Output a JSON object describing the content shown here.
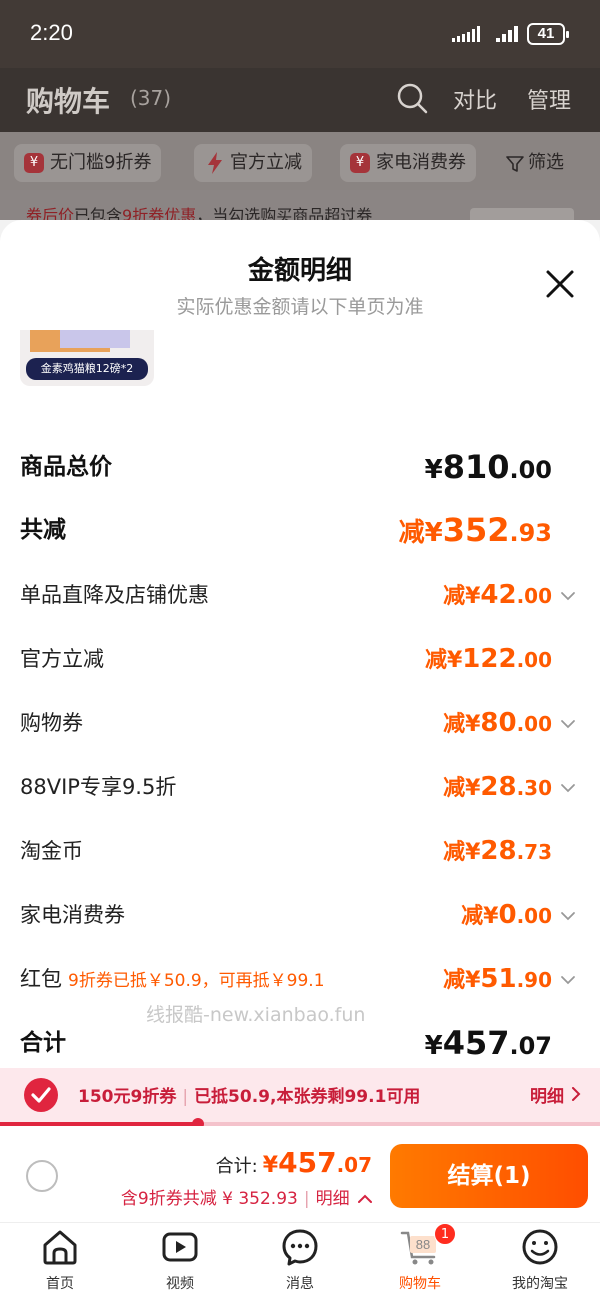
{
  "status_bar": {
    "time": "2:20",
    "battery": "41"
  },
  "cart_header": {
    "title": "购物车",
    "count": "(37)",
    "compare": "对比",
    "manage": "管理"
  },
  "filters": [
    {
      "label": "无门槛9折券",
      "icon": "coupon-icon",
      "icon_glyph": "¥"
    },
    {
      "label": "官方立减",
      "icon": "lightning-icon"
    },
    {
      "label": "家电消费券",
      "icon": "coupon-icon",
      "icon_glyph": "¥"
    }
  ],
  "filter_button": "筛选",
  "promo_strip": {
    "red1": "券后价",
    "text1": "已包含",
    "red2": "9折券优惠",
    "text2": "，当勾选购买商品超过券"
  },
  "sheet": {
    "title": "金额明细",
    "subtitle": "实际优惠金额请以下单页为准",
    "product_label": "金素鸡猫粮12磅*2",
    "rows": [
      {
        "label": "商品总价",
        "prefix": "¥",
        "int": "810",
        "dec": ".00",
        "bold": true,
        "color": "black",
        "arrow": false
      },
      {
        "label": "共减",
        "prefix": "减¥",
        "int": "352",
        "dec": ".93",
        "bold": true,
        "color": "orange",
        "arrow": false
      },
      {
        "label": "单品直降及店铺优惠",
        "prefix": "减¥",
        "int": "42",
        "dec": ".00",
        "arrow": true
      },
      {
        "label": "官方立减",
        "prefix": "减¥",
        "int": "122",
        "dec": ".00",
        "arrow": false
      },
      {
        "label": "购物券",
        "prefix": "减¥",
        "int": "80",
        "dec": ".00",
        "arrow": true
      },
      {
        "label": "88VIP专享9.5折",
        "prefix": "减¥",
        "int": "28",
        "dec": ".30",
        "arrow": true
      },
      {
        "label": "淘金币",
        "prefix": "减¥",
        "int": "28",
        "dec": ".73",
        "arrow": false
      },
      {
        "label": "家电消费券",
        "prefix": "减¥",
        "int": "0",
        "dec": ".00",
        "arrow": true
      },
      {
        "label": "红包",
        "sub_a": "9折券已抵￥50.9",
        "sub_b": "可再抵￥99.1",
        "prefix": "减¥",
        "int": "51",
        "dec": ".90",
        "arrow": true
      },
      {
        "label": "合计",
        "prefix": "¥",
        "int": "457",
        "dec": ".07",
        "bold": true,
        "color": "black",
        "arrow": false
      }
    ]
  },
  "watermark": "线报酷-new.xianbao.fun",
  "coupon_bar": {
    "name": "150元9折券",
    "status": "已抵50.9,本张券剩99.1可用",
    "detail": "明细",
    "progress": 0.33
  },
  "checkout": {
    "total_label": "合计:",
    "total_prefix": "¥",
    "total_int": "457",
    "total_dec": ".07",
    "discount_text": "含9折券共减 ¥ 352.93",
    "detail": "明细",
    "button": "结算(1)"
  },
  "nav": [
    {
      "label": "首页",
      "icon": "home-icon",
      "active": false
    },
    {
      "label": "视频",
      "icon": "video-icon",
      "active": false
    },
    {
      "label": "消息",
      "icon": "message-icon",
      "active": false
    },
    {
      "label": "购物车",
      "icon": "cart-icon",
      "active": true,
      "badge": "1",
      "cart_number": "88"
    },
    {
      "label": "我的淘宝",
      "icon": "profile-icon",
      "active": false
    }
  ],
  "colors": {
    "accent": "#ff5a00",
    "coupon_red": "#e0253f",
    "modal_bg": "#ffffff"
  }
}
